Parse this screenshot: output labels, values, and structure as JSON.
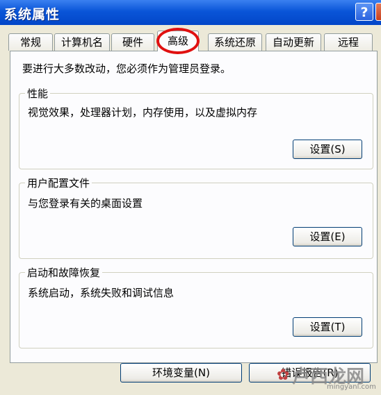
{
  "window": {
    "title": "系统属性"
  },
  "titlebar": {
    "help_glyph": "?"
  },
  "tabs": [
    {
      "label": "常规"
    },
    {
      "label": "计算机名"
    },
    {
      "label": "硬件"
    },
    {
      "label": "高级",
      "active": true
    },
    {
      "label": "系统还原"
    },
    {
      "label": "自动更新"
    },
    {
      "label": "远程"
    }
  ],
  "main": {
    "admin_note": "要进行大多数改动，您必须作为管理员登录。",
    "groups": [
      {
        "title": "性能",
        "description": "视觉效果，处理器计划，内存使用，以及虚拟内存",
        "button": "设置(S)"
      },
      {
        "title": "用户配置文件",
        "description": "与您登录有关的桌面设置",
        "button": "设置(E)"
      },
      {
        "title": "启动和故障恢复",
        "description": "系统启动，系统失败和调试信息",
        "button": "设置(T)"
      }
    ]
  },
  "bottom_buttons": {
    "env_vars": "环境变量(N)",
    "error_report": "错误报告(R)"
  },
  "watermark": {
    "text": "卢西龙网",
    "url": "mingyanl.com"
  },
  "colors": {
    "titlebar": "#0a55d8",
    "dialog": "#ece9d8",
    "panel": "#fcfcfe",
    "highlight_circle": "#e01010"
  }
}
